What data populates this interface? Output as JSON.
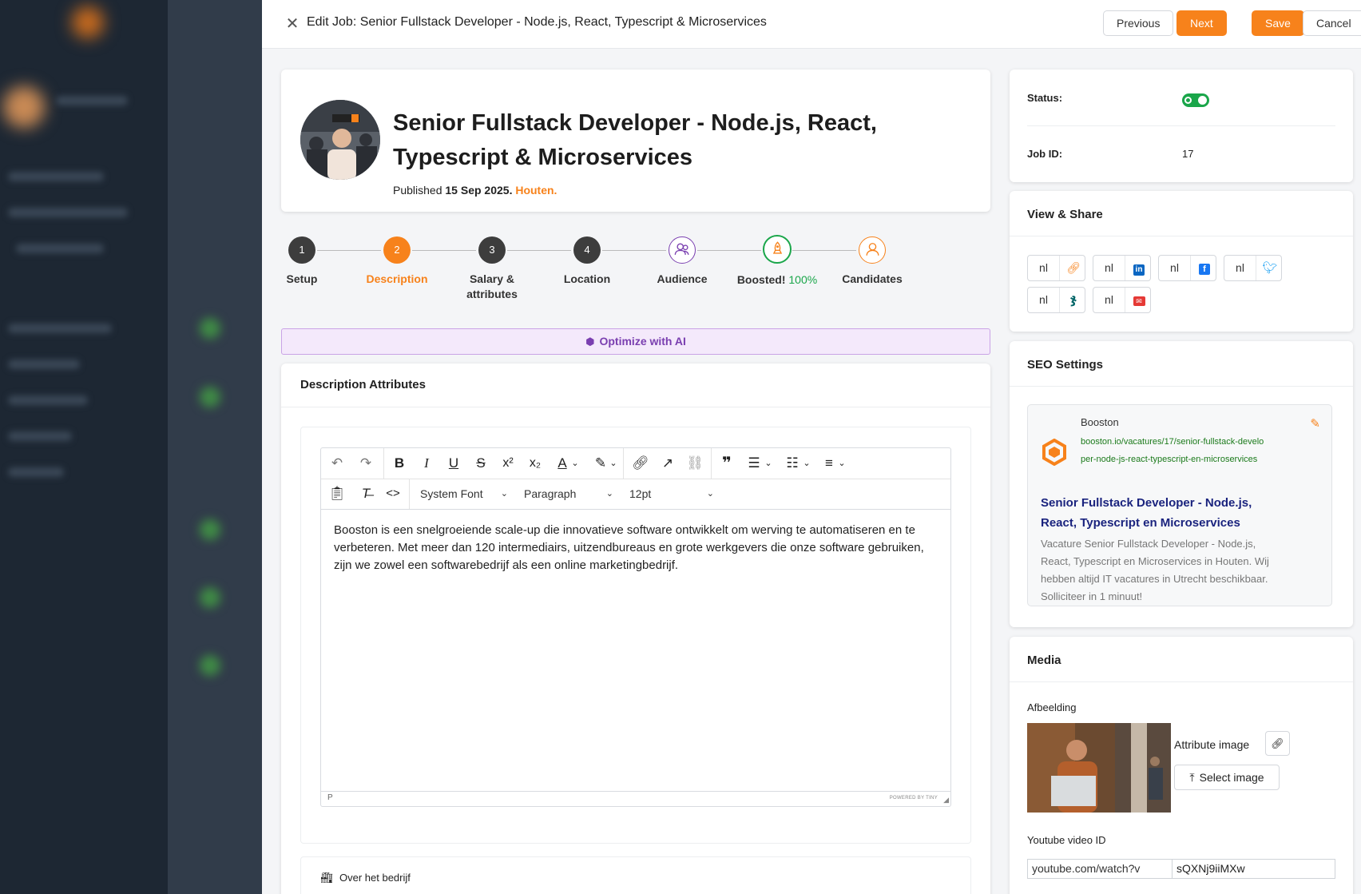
{
  "header": {
    "title": "Edit Job: Senior Fullstack Developer - Node.js, React, Typescript & Microservices",
    "previous_label": "Previous",
    "next_label": "Next",
    "save_label": "Save",
    "cancel_label": "Cancel"
  },
  "job": {
    "title": "Senior Fullstack Developer - Node.js, React, Typescript & Microservices",
    "published_prefix": "Published",
    "published_date": "15 Sep 2025.",
    "city": "Houten."
  },
  "steps": [
    {
      "number": "1",
      "label": "Setup",
      "state": "done"
    },
    {
      "number": "2",
      "label": "Description",
      "state": "active"
    },
    {
      "number": "3",
      "label": "Salary & attributes",
      "state": "done"
    },
    {
      "number": "4",
      "label": "Location",
      "state": "done"
    },
    {
      "number": "",
      "label": "Audience",
      "state": "icon"
    },
    {
      "number": "",
      "label": "Boosted!",
      "percent": "100%",
      "state": "boosted"
    },
    {
      "number": "",
      "label": "Candidates",
      "state": "icon-orange"
    }
  ],
  "ai": {
    "label": "Optimize with AI"
  },
  "description": {
    "title": "Description Attributes",
    "font_family": "System Font",
    "block_format": "Paragraph",
    "font_size": "12pt",
    "body": "Booston is een snelgroeiende scale-up die innovatieve software ontwikkelt om werving te automatiseren en te verbeteren. Met meer dan 120 intermediairs, uitzendbureaus en grote werkgevers die onze software gebruiken, zijn we zowel een softwarebedrijf als een online marketingbedrijf.",
    "status_path": "P",
    "powered_by": "POWERED BY TINY"
  },
  "company": {
    "label": "Over het bedrijf"
  },
  "status": {
    "label": "Status:",
    "job_id_label": "Job ID:",
    "job_id": "17",
    "enabled": true
  },
  "share": {
    "title": "View & Share",
    "items": [
      {
        "lang": "nl",
        "icon": "link-icon",
        "color": "#f7821b"
      },
      {
        "lang": "nl",
        "icon": "linkedin-icon",
        "color": "#0a66c2"
      },
      {
        "lang": "nl",
        "icon": "facebook-icon",
        "color": "#1877f2"
      },
      {
        "lang": "nl",
        "icon": "twitter-icon",
        "color": "#1da1f2"
      },
      {
        "lang": "nl",
        "icon": "xing-icon",
        "color": "#006567"
      },
      {
        "lang": "nl",
        "icon": "email-icon",
        "color": "#e53935"
      }
    ]
  },
  "seo": {
    "title": "SEO Settings",
    "site_name": "Booston",
    "url": "booston.io/vacatures/17/senior-fullstack-developer-node-js-react-typescript-en-microservices",
    "headline": "Senior Fullstack Developer - Node.js, React, Typescript en Microservices",
    "description": "Vacature Senior Fullstack Developer - Node.js, React, Typescript en Microservices in Houten. Wij hebben altijd IT vacatures in Utrecht beschikbaar. Solliciteer in 1 minuut!"
  },
  "media": {
    "title": "Media",
    "image_label": "Afbeelding",
    "attribute_label": "Attribute image",
    "select_label": "Select image",
    "youtube_label": "Youtube video ID",
    "youtube_prefix": "youtube.com/watch?v",
    "youtube_value": "sQXNj9iiMXw"
  },
  "colors": {
    "accent": "#f7821b",
    "success": "#1aa64a",
    "ai": "#7a3fb0",
    "seo_headline": "#1a237e",
    "seo_url": "#1b7a1b"
  }
}
